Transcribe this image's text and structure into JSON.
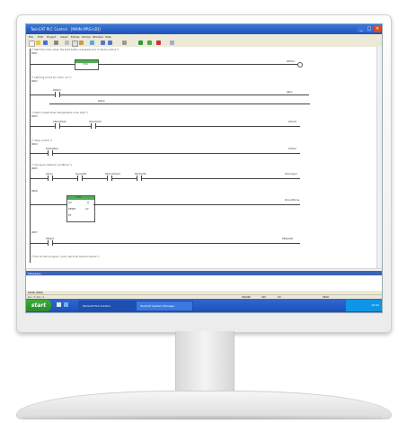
{
  "window": {
    "title": "TwinCAT PLC Control - [MAIN (PRG-LD)]",
    "controls": [
      "minimize",
      "maximize",
      "close"
    ]
  },
  "menu": [
    "File",
    "Edit",
    "Project",
    "Insert",
    "Extras",
    "Online",
    "Window",
    "Help"
  ],
  "toolbar": {
    "icons": [
      "new-icon",
      "open-icon",
      "save-icon",
      "print-icon",
      "cut-icon",
      "copy-icon",
      "paste-icon",
      "find-icon",
      "undo-icon",
      "redo-icon",
      "compile-icon",
      "login-icon",
      "run-icon",
      "stop-icon",
      "zoom-icon"
    ]
  },
  "ladder": {
    "rungs": [
      {
        "number": "0001",
        "comment": "(* Start the motor when the start button is pressed and no fault is active *)",
        "contacts": [
          "bStart",
          "bNoFault"
        ],
        "function_block": "TON",
        "coil": "bMotor"
      },
      {
        "number": "0002",
        "comment": "(* Latching circuit for motor run *)",
        "contacts": [
          "bMotor",
          "bStop"
        ],
        "coil": "bRun"
      },
      {
        "number": "0003",
        "comment": "(* Alarm output when temperature is too high *)",
        "contacts": [
          "bTempHigh",
          "bAlarmAck"
        ],
        "coil": "bAlarm"
      },
      {
        "number": "0004",
        "comment": "(* Valve control *)",
        "contacts": [
          "bValveReq"
        ],
        "coil": "bValve"
      },
      {
        "number": "0005",
        "comment": "(* Conveyor interlock conditions *)",
        "contacts": [
          "bAuto",
          "bLevelOK",
          "bDoorClosed",
          "bPumpOK"
        ],
        "coil": "bConveyor"
      },
      {
        "number": "0006",
        "comment": "",
        "function_block": "CTU",
        "block_inputs": [
          "CU",
          "RESET",
          "PV"
        ],
        "block_outputs": [
          "Q",
          "CV"
        ],
        "coil": "bCountDone"
      },
      {
        "number": "0007",
        "comment": "",
        "contacts": [
          "bReset"
        ],
        "coil": "bResetAll"
      }
    ],
    "footer_comment": "(* End of main program, cyclic call of all function blocks *)"
  },
  "output_panel": {
    "title": "Messages"
  },
  "tabs": {
    "label": "MAIN (PRG)"
  },
  "status": {
    "position": "Lin.: 7, Col.: 1",
    "mode": "ONLINE",
    "sim": "SIM",
    "ovr": "OV",
    "ins": "READ"
  },
  "taskbar": {
    "start_label": "start",
    "tasks": [
      "TwinCAT PLC Control",
      "TwinCAT System Manager"
    ],
    "clock": "10:42"
  },
  "colors": {
    "title_blue": "#1c52b8",
    "taskbar_blue": "#3168d5",
    "start_green": "#2b8a2b",
    "menu_grey": "#ece9d8",
    "fb_green": "#4caf50"
  }
}
